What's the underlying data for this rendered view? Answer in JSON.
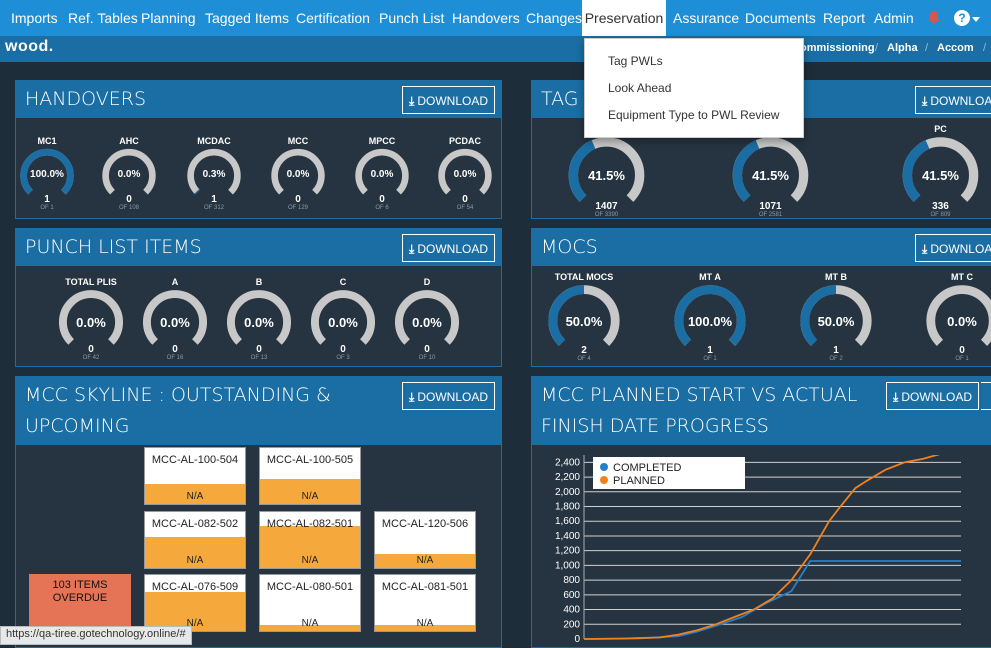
{
  "nav": {
    "items": [
      "Imports",
      "Ref. Tables",
      "Planning",
      "Tagged Items",
      "Certification",
      "Punch List",
      "Handovers",
      "Changes",
      "Preservation",
      "Assurance",
      "Documents",
      "Report",
      "Admin"
    ],
    "active": "Preservation"
  },
  "logo": "wood.",
  "breadcrumb": [
    "ommissioning",
    "Alpha",
    "Accom"
  ],
  "dropdown": [
    "Tag PWLs",
    "Look Ahead",
    "Equipment Type to PWL Review"
  ],
  "download_label": "DOWNLOAD",
  "handovers": {
    "title": "HANDOVERS",
    "gauges": [
      {
        "label": "MC1",
        "pct": "100.0%",
        "count": "1",
        "of": "OF 1",
        "fill": 1.0
      },
      {
        "label": "AHC",
        "pct": "0.0%",
        "count": "0",
        "of": "OF 108",
        "fill": 0
      },
      {
        "label": "MCDAC",
        "pct": "0.3%",
        "count": "1",
        "of": "OF 312",
        "fill": 0.003
      },
      {
        "label": "MCC",
        "pct": "0.0%",
        "count": "0",
        "of": "OF 129",
        "fill": 0
      },
      {
        "label": "MPCC",
        "pct": "0.0%",
        "count": "0",
        "of": "OF 6",
        "fill": 0
      },
      {
        "label": "PCDAC",
        "pct": "0.0%",
        "count": "0",
        "of": "OF 54",
        "fill": 0
      }
    ]
  },
  "tag_items": {
    "title": "TAG IT",
    "gauges": [
      {
        "label": "",
        "pct": "41.5%",
        "count": "1407",
        "of": "OF 3390",
        "fill": 0.415
      },
      {
        "label": "",
        "pct": "41.5%",
        "count": "1071",
        "of": "OF 2581",
        "fill": 0.415
      },
      {
        "label": "PC",
        "pct": "41.5%",
        "count": "336",
        "of": "OF 809",
        "fill": 0.415
      }
    ]
  },
  "punch_list": {
    "title": "PUNCH LIST ITEMS",
    "gauges": [
      {
        "label": "TOTAL PLIS",
        "pct": "0.0%",
        "count": "0",
        "of": "OF 42",
        "fill": 0
      },
      {
        "label": "A",
        "pct": "0.0%",
        "count": "0",
        "of": "OF 16",
        "fill": 0
      },
      {
        "label": "B",
        "pct": "0.0%",
        "count": "0",
        "of": "OF 13",
        "fill": 0
      },
      {
        "label": "C",
        "pct": "0.0%",
        "count": "0",
        "of": "OF 3",
        "fill": 0
      },
      {
        "label": "D",
        "pct": "0.0%",
        "count": "0",
        "of": "OF 10",
        "fill": 0
      }
    ]
  },
  "mocs": {
    "title": "MOCS",
    "gauges": [
      {
        "label": "TOTAL MOCS",
        "pct": "50.0%",
        "count": "2",
        "of": "OF 4",
        "fill": 0.5
      },
      {
        "label": "MT A",
        "pct": "100.0%",
        "count": "1",
        "of": "OF 1",
        "fill": 1.0
      },
      {
        "label": "MT B",
        "pct": "50.0%",
        "count": "1",
        "of": "OF 2",
        "fill": 0.5
      },
      {
        "label": "MT C",
        "pct": "0.0%",
        "count": "0",
        "of": "OF 1",
        "fill": 0
      }
    ]
  },
  "skyline": {
    "title_line1": "MCC SKYLINE : OUTSTANDING &",
    "title_line2": "UPCOMING",
    "overdue_line1": "103 ITEMS",
    "overdue_line2": "OVERDUE",
    "na": "N/A",
    "cards": [
      {
        "id": "MCC-AL-100-504",
        "fill": 0.35
      },
      {
        "id": "MCC-AL-100-505",
        "fill": 0.45
      },
      {
        "id": "MCC-AL-082-502",
        "fill": 0.55
      },
      {
        "id": "MCC-AL-082-501",
        "fill": 0.75
      },
      {
        "id": "MCC-AL-120-506",
        "fill": 0.25
      },
      {
        "id": "MCC-AL-076-509",
        "fill": 0.7
      },
      {
        "id": "MCC-AL-080-501",
        "fill": 0.1
      },
      {
        "id": "MCC-AL-081-501",
        "fill": 0.1
      }
    ]
  },
  "planned": {
    "title_line1": "MCC PLANNED START VS ACTUAL",
    "title_line2": "FINISH DATE PROGRESS"
  },
  "colors": {
    "completed": "#2a7fc4",
    "planned": "#f0821e",
    "gauge_fill": "#1a6ea3",
    "gauge_track": "#c8c8c8"
  },
  "chart_data": {
    "type": "line",
    "legend": [
      "COMPLETED",
      "PLANNED"
    ],
    "legend_position": "top-left",
    "ylim": [
      0,
      2500
    ],
    "yticks": [
      0,
      200,
      400,
      600,
      800,
      1000,
      1200,
      1400,
      1600,
      1800,
      2000,
      2200,
      2400
    ],
    "ytick_labels": [
      "0",
      "200",
      "400",
      "600",
      "800",
      "1,000",
      "1,200",
      "1,400",
      "1,600",
      "1,800",
      "2,000",
      "2,200",
      "2,400"
    ],
    "xlim": [
      0,
      100
    ],
    "series": [
      {
        "name": "COMPLETED",
        "x": [
          0,
          15,
          25,
          30,
          35,
          42,
          48,
          55,
          60,
          65,
          75,
          100
        ],
        "y": [
          0,
          10,
          40,
          100,
          180,
          300,
          480,
          650,
          1060,
          1060,
          1060,
          1060
        ]
      },
      {
        "name": "PLANNED",
        "x": [
          0,
          10,
          20,
          25,
          30,
          35,
          40,
          45,
          50,
          55,
          60,
          65,
          68,
          72,
          75,
          80,
          85,
          90,
          95,
          100
        ],
        "y": [
          0,
          5,
          20,
          60,
          120,
          200,
          300,
          400,
          550,
          800,
          1150,
          1600,
          1800,
          2050,
          2150,
          2300,
          2400,
          2450,
          2520,
          2540
        ]
      }
    ]
  },
  "status_url": "https://qa-tiree.gotechnology.online/#"
}
